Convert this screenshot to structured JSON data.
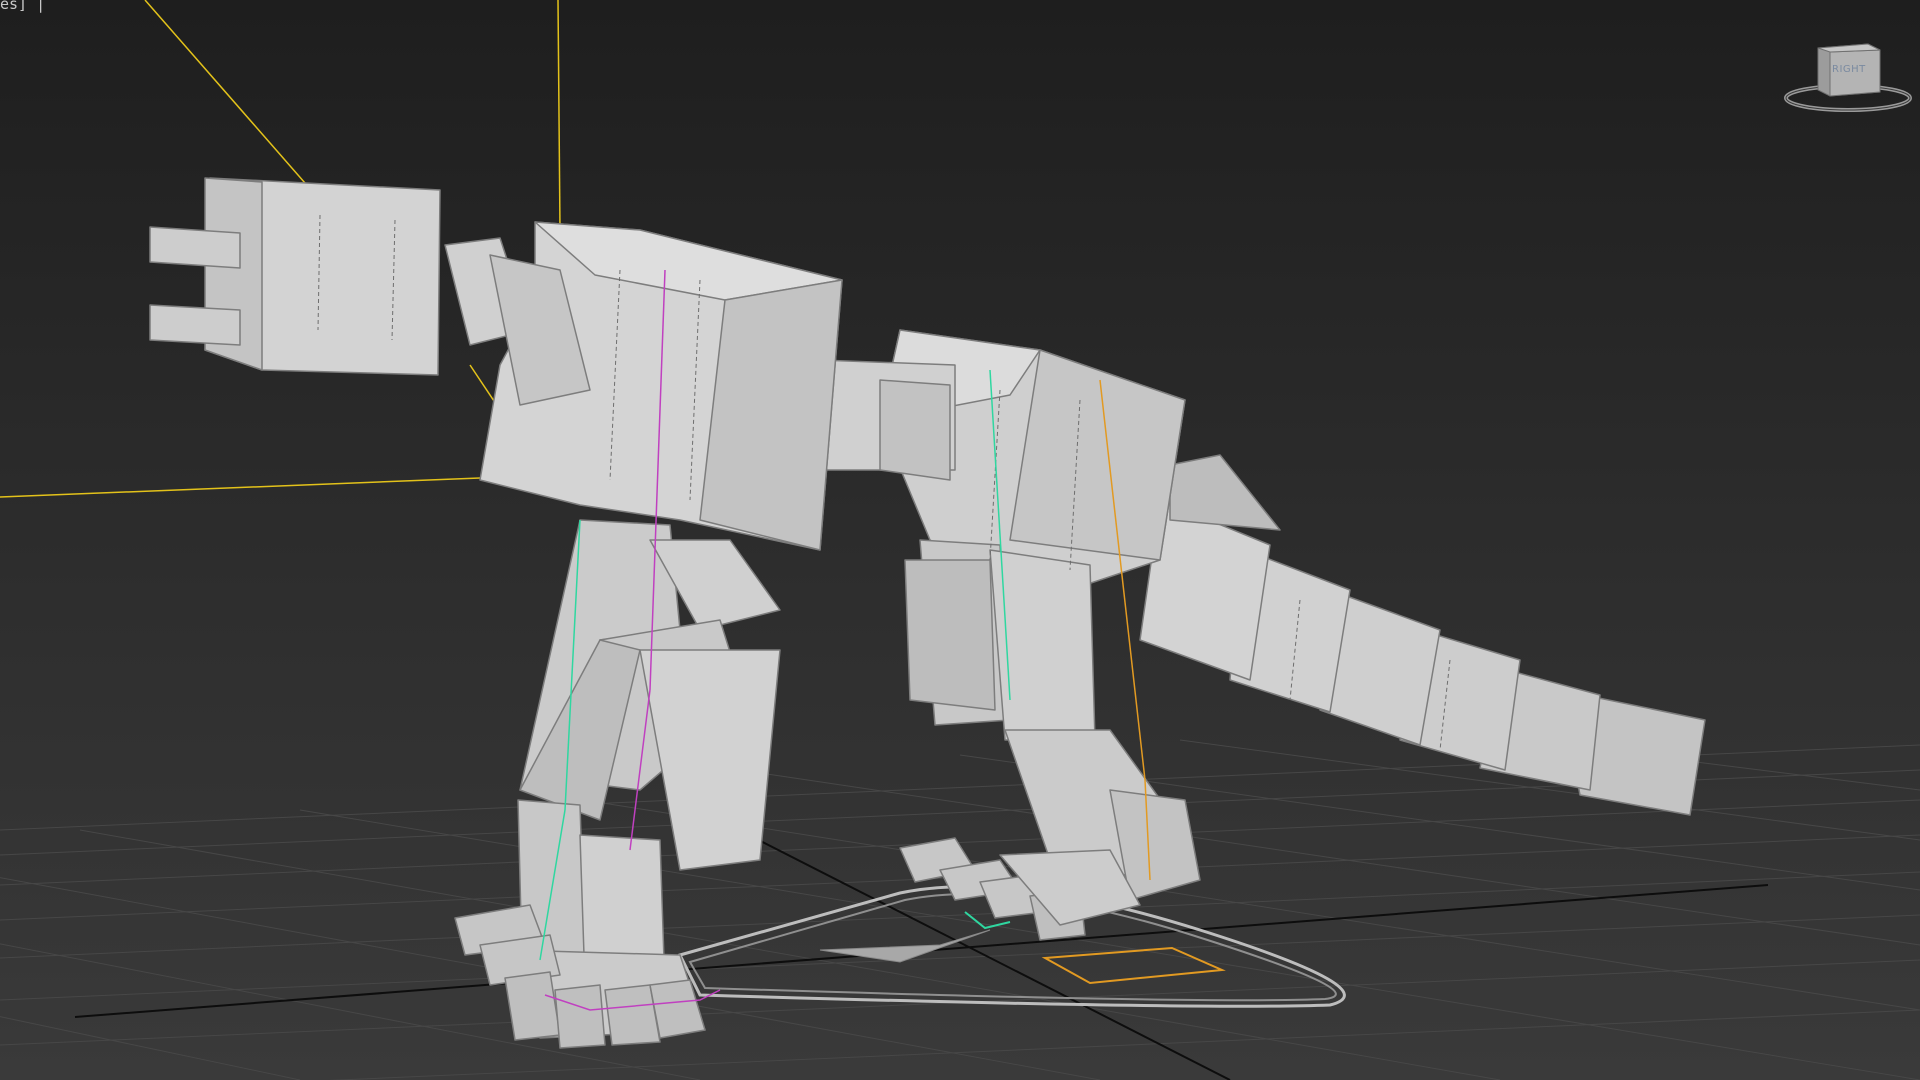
{
  "viewport": {
    "label": "es] |",
    "background_top": "#1e1e1e",
    "background_bottom": "#3a3a3a"
  },
  "viewcube": {
    "face_label": "RIGHT"
  },
  "colors": {
    "grid": "#474747",
    "axis": "#0e0e0e",
    "mesh_fill": "#c9c9c9",
    "mesh_edge": "#7d7d7d",
    "helper_yellow": "#e3c21a",
    "bone_green": "#2fd7a0",
    "bone_magenta": "#c040c0",
    "ik_orange": "#e29a22"
  }
}
